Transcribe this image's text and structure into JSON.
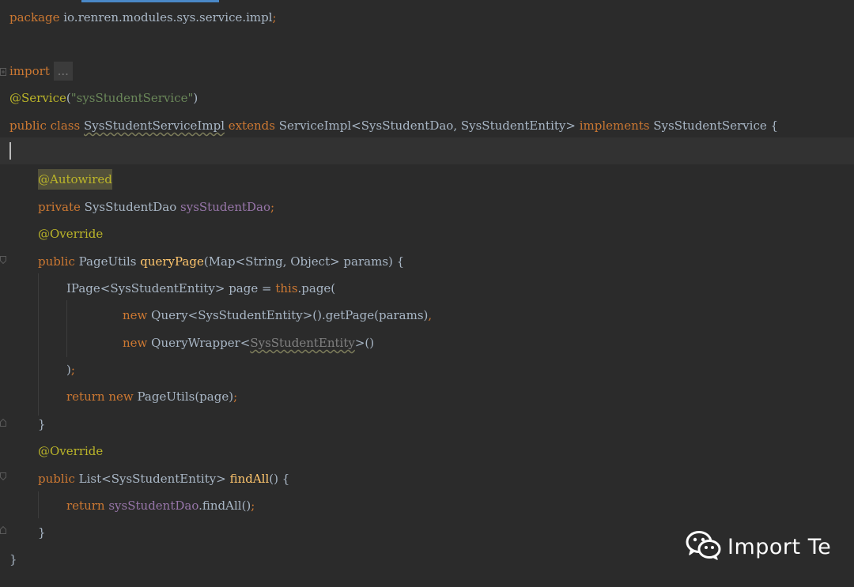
{
  "colors": {
    "background": "#2b2b2b",
    "keyword": "#cc7832",
    "annotation": "#bbb529",
    "string": "#6a8759",
    "field": "#9876aa",
    "method": "#ffc66d",
    "text": "#a9b7c6"
  },
  "code": {
    "package_kw": "package",
    "package_name": " io.renren.modules.sys.service.impl",
    "semi": ";",
    "import_kw": "import",
    "import_folded": "...",
    "service_ann": "@Service",
    "service_open": "(",
    "service_str": "\"sysStudentService\"",
    "service_close": ")",
    "public_kw": "public",
    "class_kw": "class",
    "class_name": "SysStudentServiceImpl",
    "extends_kw": "extends",
    "extends_type": " ServiceImpl<SysStudentDao, SysStudentEntity> ",
    "implements_kw": "implements",
    "implements_type": " SysStudentService {",
    "autowired_ann": "@Autowired",
    "private_kw": "private",
    "dao_type": " SysStudentDao ",
    "dao_field": "sysStudentDao",
    "override_ann": "@Override",
    "pageutils_type": " PageUtils ",
    "querypage_method": "queryPage",
    "querypage_params": "(Map<String, Object> params) {",
    "ipage_decl": "IPage<SysStudentEntity> page = ",
    "this_kw": "this",
    "page_call": ".page(",
    "new_kw": "new",
    "query_call": " Query<SysStudentEntity>().getPage(params)",
    "comma": ",",
    "querywrapper_open": " QueryWrapper<",
    "querywrapper_type": "SysStudentEntity",
    "querywrapper_close": ">()",
    "close_paren": ")",
    "return_kw": "return",
    "new_pageutils": " PageUtils(page)",
    "close_brace": "}",
    "list_type": " List<SysStudentEntity> ",
    "findall_method": "findAll",
    "findall_params": "() {",
    "dao_call_method": ".findAll()"
  },
  "watermark": {
    "icon": "wechat-icon",
    "text": "Import Te"
  }
}
